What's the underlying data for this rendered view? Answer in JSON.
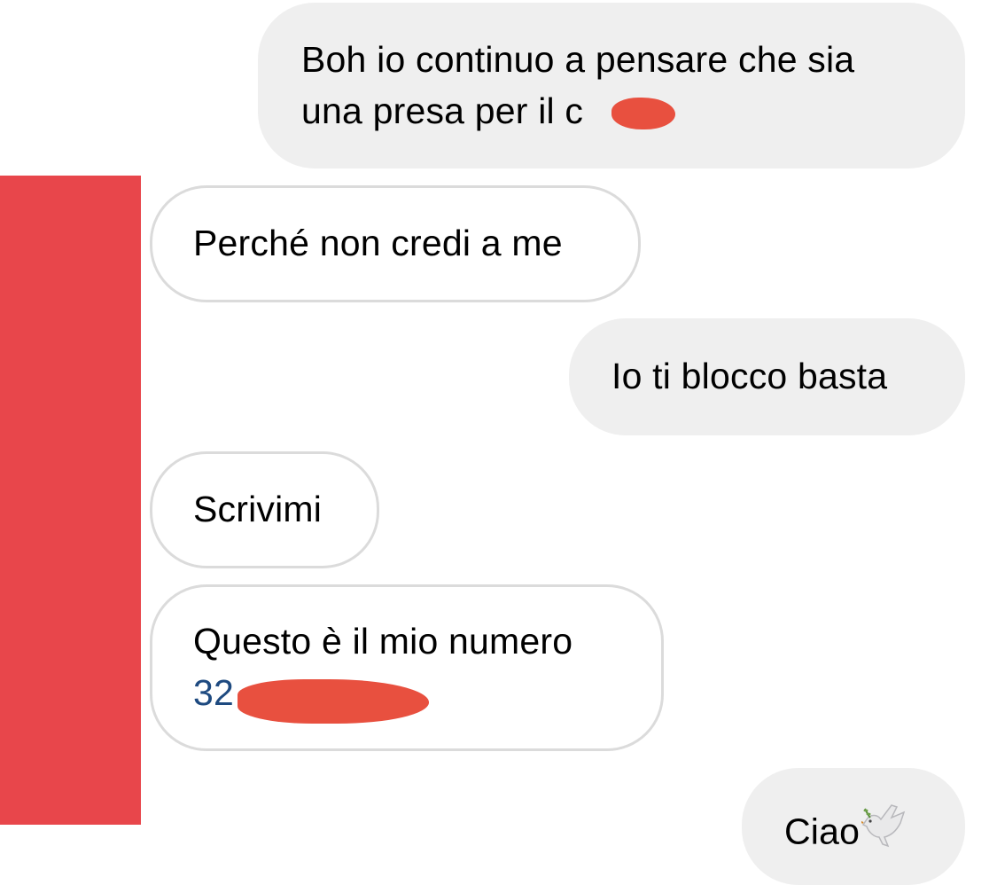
{
  "messages": [
    {
      "direction": "sent",
      "text_line1": "Boh io continuo a pensare che sia",
      "text_line2": "una presa per il c",
      "redacted": true
    },
    {
      "direction": "received",
      "text": "Perché non credi a me"
    },
    {
      "direction": "sent",
      "text": "Io ti blocco basta"
    },
    {
      "direction": "received",
      "text": "Scrivimi"
    },
    {
      "direction": "received",
      "text_line1": "Questo è il mio numero",
      "phone_visible": "32",
      "redacted": true
    },
    {
      "direction": "sent",
      "text": "Ciao",
      "emoji": "dove-icon"
    }
  ],
  "colors": {
    "sent_bubble": "#efefef",
    "received_border": "#dbdbdb",
    "redaction_bar": "#e8464b",
    "scribble": "#e8503f",
    "link": "#1e4a80"
  }
}
